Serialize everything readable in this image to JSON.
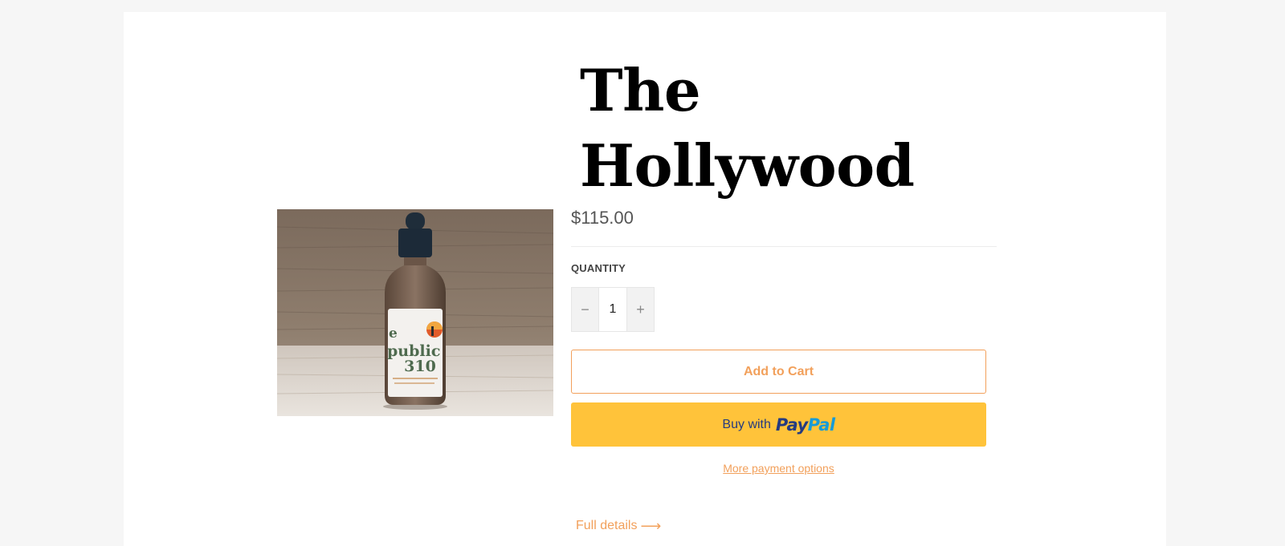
{
  "product": {
    "title_line1": "The",
    "title_line2": "Hollywood",
    "price": "$115.00",
    "image_label": {
      "line1": "e",
      "line2": "public",
      "line3": "310"
    }
  },
  "quantity": {
    "label": "QUANTITY",
    "value": "1",
    "minus": "−",
    "plus": "+"
  },
  "actions": {
    "add_to_cart": "Add to Cart",
    "paypal_prefix": "Buy with",
    "paypal_pay": "Pay",
    "paypal_pal": "Pal",
    "more_options": "More payment options",
    "full_details": "Full details",
    "arrow": "⟶"
  },
  "colors": {
    "accent": "#f2a05b",
    "paypal_bg": "#ffc33a",
    "paypal_dark": "#253b80",
    "paypal_light": "#179bd7"
  }
}
